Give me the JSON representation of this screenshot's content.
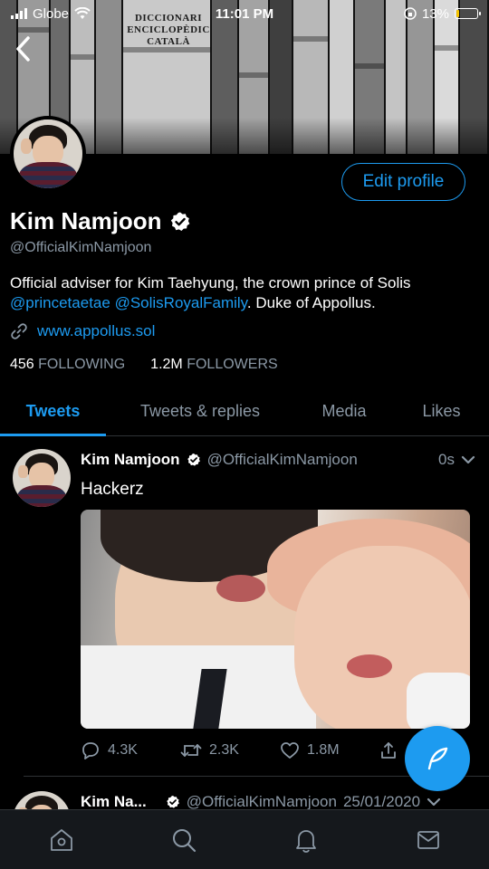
{
  "status_bar": {
    "carrier": "Globe",
    "time": "11:01 PM",
    "battery_percent": "13%",
    "battery_level": 0.13
  },
  "banner": {
    "book_title": "DICCIONARI ENCICLOPÈDIC CATALÀ"
  },
  "profile": {
    "name": "Kim Namjoon",
    "handle": "@OfficialKimNamjoon",
    "edit_button": "Edit profile",
    "bio_text_1": "Official adviser for Kim Taehyung, the crown prince of Solis ",
    "bio_mention_1": "@princetaetae",
    "bio_space": " ",
    "bio_mention_2": "@SolisRoyalFamily",
    "bio_text_2": ". Duke of Appollus.",
    "website": "www.appollus.sol",
    "following_count": "456",
    "following_label": "FOLLOWING",
    "followers_count": "1.2M",
    "followers_label": "FOLLOWERS"
  },
  "tabs": [
    {
      "label": "Tweets",
      "active": true
    },
    {
      "label": "Tweets & replies",
      "active": false
    },
    {
      "label": "Media",
      "active": false
    },
    {
      "label": "Likes",
      "active": false
    }
  ],
  "tweets": [
    {
      "name": "Kim Namjoon",
      "handle": "@OfficialKimNamjoon",
      "time": "0s",
      "text": "Hackerz",
      "replies": "4.3K",
      "retweets": "2.3K",
      "likes": "1.8M"
    },
    {
      "name": "Kim Na...",
      "handle": "@OfficialKimNamjoon",
      "time": "25/01/2020"
    }
  ],
  "colors": {
    "accent": "#1d9bf0",
    "muted": "#8b98a5",
    "background": "#000000"
  },
  "icons": {
    "back": "chevron-left-icon",
    "verified": "verified-badge-icon",
    "link": "link-icon",
    "reply": "reply-icon",
    "retweet": "retweet-icon",
    "like": "heart-icon",
    "share": "share-icon",
    "compose": "compose-tweet-icon",
    "nav": [
      "home-icon",
      "search-icon",
      "bell-icon",
      "mail-icon"
    ]
  }
}
